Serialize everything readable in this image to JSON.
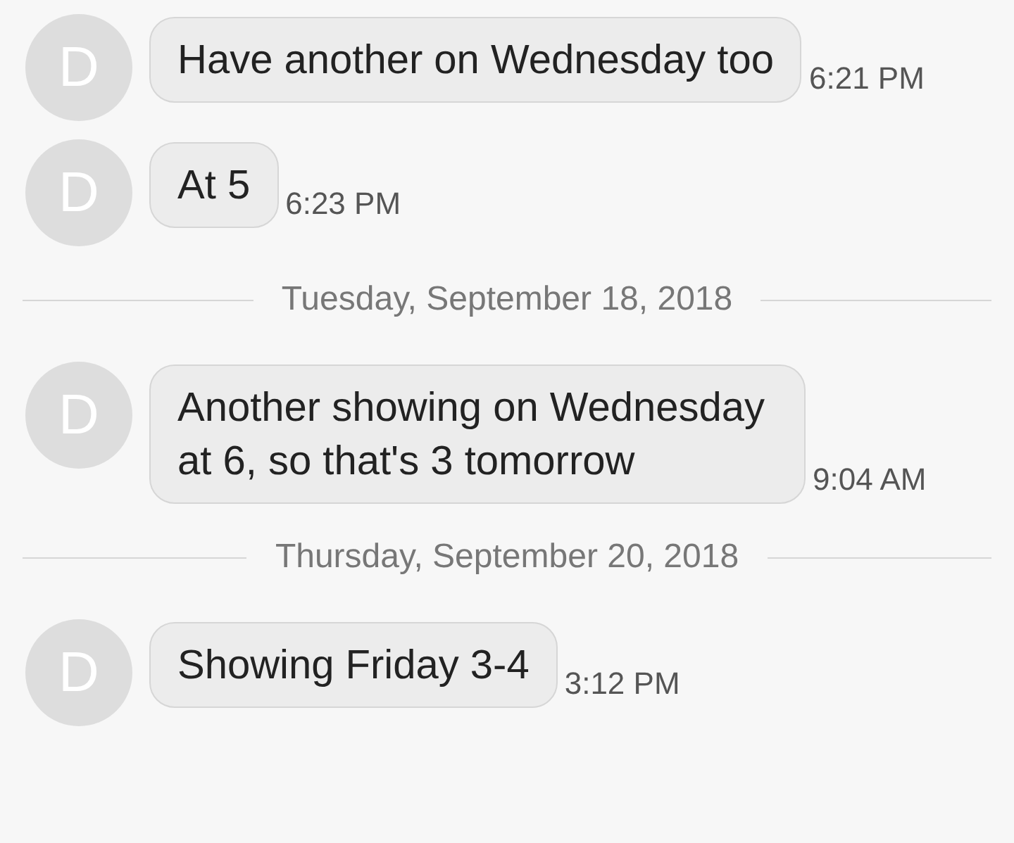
{
  "items": [
    {
      "kind": "message",
      "avatar": "D",
      "text": "Have another on Wednesday too",
      "time": "6:21 PM"
    },
    {
      "kind": "message",
      "avatar": "D",
      "text": "At 5",
      "time": "6:23 PM"
    },
    {
      "kind": "date",
      "text": "Tuesday, September 18, 2018"
    },
    {
      "kind": "message",
      "avatar": "D",
      "text": "Another showing on Wednesday at 6, so that's 3 tomorrow",
      "time": "9:04 AM"
    },
    {
      "kind": "date",
      "text": "Thursday, September 20, 2018"
    },
    {
      "kind": "message",
      "avatar": "D",
      "text": "Showing Friday 3-4",
      "time": "3:12 PM"
    }
  ]
}
